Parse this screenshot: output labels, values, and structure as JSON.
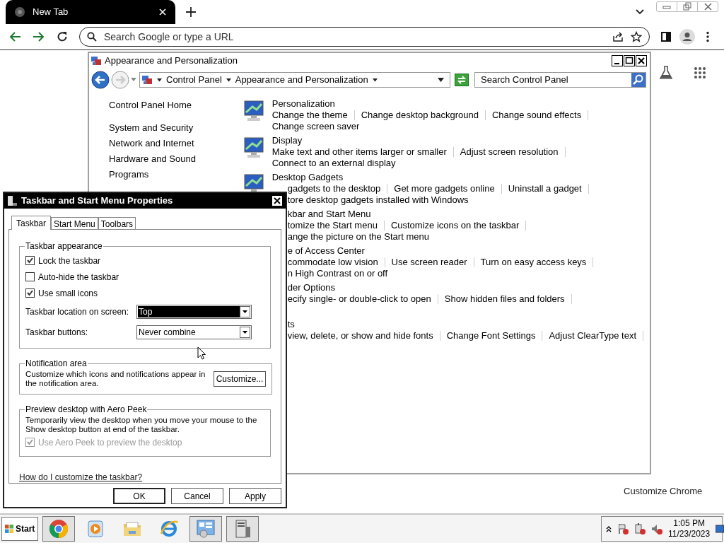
{
  "browser": {
    "tab": {
      "title": "New Tab"
    },
    "omnibox": {
      "placeholder": "Search Google or type a URL"
    },
    "customize_label": "Customize Chrome"
  },
  "control_panel": {
    "title": "Appearance and Personalization",
    "breadcrumb": [
      "Control Panel",
      "Appearance and Personalization"
    ],
    "search": {
      "placeholder": "Search Control Panel"
    },
    "sidebar": [
      {
        "label": "Control Panel Home"
      },
      {
        "label": "System and Security"
      },
      {
        "label": "Network and Internet"
      },
      {
        "label": "Hardware and Sound"
      },
      {
        "label": "Programs"
      }
    ],
    "categories": [
      {
        "title": "Personalization",
        "title_covered": false,
        "icon": true,
        "rows": [
          {
            "links": [
              "Change the theme",
              "Change desktop background",
              "Change sound effects"
            ],
            "covered": false
          },
          {
            "links": [
              "Change screen saver"
            ],
            "covered": false
          }
        ]
      },
      {
        "title": "Display",
        "title_covered": false,
        "icon": true,
        "rows": [
          {
            "links": [
              "Make text and other items larger or smaller",
              "Adjust screen resolution"
            ],
            "covered": false
          },
          {
            "links": [
              "Connect to an external display"
            ],
            "covered": false
          }
        ]
      },
      {
        "title": "Desktop Gadgets",
        "title_covered": false,
        "icon": true,
        "rows": [
          {
            "links": [
              "gadgets to the desktop",
              "Get more gadgets online",
              "Uninstall a gadget"
            ],
            "covered": true
          },
          {
            "links": [
              "tore desktop gadgets installed with Windows"
            ],
            "covered": true
          }
        ]
      },
      {
        "title": "kbar and Start Menu",
        "title_covered": true,
        "icon": false,
        "rows": [
          {
            "links": [
              "tomize the Start menu",
              "Customize icons on the taskbar"
            ],
            "covered": true
          },
          {
            "links": [
              "ange the picture on the Start menu"
            ],
            "covered": true
          }
        ]
      },
      {
        "title": "e of Access Center",
        "title_covered": true,
        "icon": false,
        "rows": [
          {
            "links": [
              "commodate low vision",
              "Use screen reader",
              "Turn on easy access keys"
            ],
            "covered": true
          },
          {
            "links": [
              "n High Contrast on or off"
            ],
            "covered": true
          }
        ]
      },
      {
        "title": "der Options",
        "title_covered": true,
        "icon": false,
        "rows": [
          {
            "links": [
              "ecify single- or double-click to open",
              "Show hidden files and folders"
            ],
            "covered": true
          }
        ]
      },
      {
        "title": "ts",
        "title_covered": true,
        "icon": false,
        "rows": [
          {
            "links": [
              "view, delete, or show and hide fonts",
              "Change Font Settings",
              "Adjust ClearType text"
            ],
            "covered": true
          }
        ]
      }
    ]
  },
  "dialog": {
    "title": "Taskbar and Start Menu Properties",
    "tabs": [
      {
        "label": "Taskbar",
        "selected": true
      },
      {
        "label": "Start Menu",
        "selected": false
      },
      {
        "label": "Toolbars",
        "selected": false
      }
    ],
    "appearance": {
      "legend": "Taskbar appearance",
      "checkboxes": [
        {
          "label": "Lock the taskbar",
          "checked": true
        },
        {
          "label": "Auto-hide the taskbar",
          "checked": false
        },
        {
          "label": "Use small icons",
          "checked": true
        }
      ],
      "dropdowns": [
        {
          "label": "Taskbar location on screen:",
          "value": "Top",
          "focused": true
        },
        {
          "label": "Taskbar buttons:",
          "value": "Never combine",
          "focused": false
        }
      ]
    },
    "notification": {
      "legend": "Notification area",
      "text": "Customize which icons and notifications appear in the notification area.",
      "button": "Customize..."
    },
    "peek": {
      "legend": "Preview desktop with Aero Peek",
      "text": "Temporarily view the desktop when you move your mouse to the Show desktop button at end of the taskbar.",
      "checkbox": {
        "label": "Use Aero Peek to preview the desktop",
        "checked": true,
        "disabled": true
      }
    },
    "help_link": "How do I customize the taskbar?",
    "buttons": [
      {
        "label": "OK",
        "default": true
      },
      {
        "label": "Cancel",
        "default": false
      },
      {
        "label": "Apply",
        "default": false
      }
    ]
  },
  "taskbar": {
    "start": "Start",
    "apps": [
      {
        "kind": "chrome",
        "running": true
      },
      {
        "kind": "media",
        "running": false
      },
      {
        "kind": "folder",
        "running": false
      },
      {
        "kind": "ie",
        "running": false
      },
      {
        "kind": "control",
        "running": true
      },
      {
        "kind": "server",
        "running": true
      }
    ],
    "time": "1:05 PM",
    "date": "11/23/2023"
  }
}
